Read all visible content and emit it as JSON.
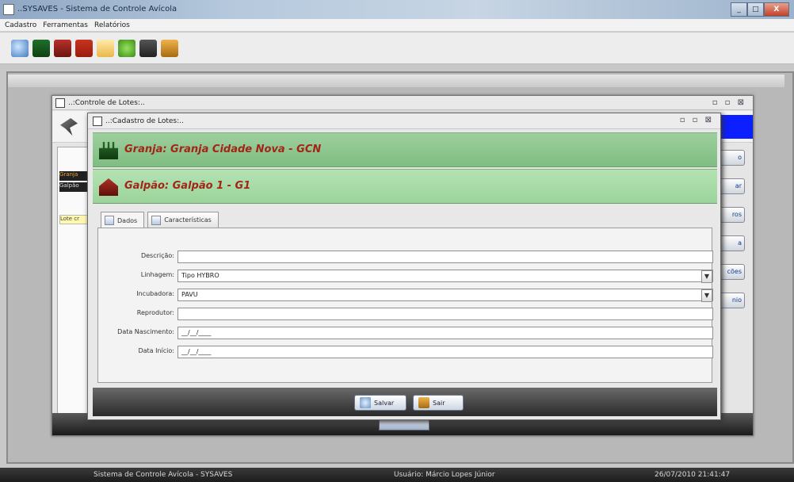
{
  "window": {
    "title": "..SYSAVES - Sistema de Controle Avícola",
    "controls": [
      "_",
      "□",
      "X"
    ]
  },
  "menu": [
    "Cadastro",
    "Ferramentas",
    "Relatórios"
  ],
  "toolbar": {
    "icons": [
      "world-icon",
      "farm-icon",
      "barn-icon",
      "bird-icon",
      "document-icon",
      "leaf-icon",
      "book-icon",
      "exit-door-icon"
    ]
  },
  "lotes_window": {
    "title": "..:Controle de Lotes:..",
    "granja_tag": "Granja",
    "galpao_tag": "Galpão",
    "lote_tag": "Lote cr",
    "side_buttons": [
      "o",
      "ar",
      "ros",
      "a",
      "cões",
      "nio"
    ]
  },
  "cadastro_window": {
    "title": "..:Cadastro de Lotes:..",
    "granja_banner": "Granja: Granja Cidade Nova - GCN",
    "galpao_banner": "Galpão: Galpão 1 - G1",
    "tabs": [
      {
        "label": "Dados",
        "active": true
      },
      {
        "label": "Características",
        "active": false
      }
    ],
    "fields": {
      "descricao": {
        "label": "Descrição:",
        "value": ""
      },
      "linhagem": {
        "label": "Linhagem:",
        "value": "Tipo HYBRO"
      },
      "incubadora": {
        "label": "Incubadora:",
        "value": "PAVU"
      },
      "reprodutor": {
        "label": "Reprodutor:",
        "value": ""
      },
      "data_nascimento": {
        "label": "Data Nascimento:",
        "value": "__/__/____"
      },
      "data_inicio": {
        "label": "Data Início:",
        "value": "__/__/____"
      }
    },
    "buttons": {
      "save": "Salvar",
      "exit": "Sair"
    }
  },
  "status": {
    "system": "Sistema de Controle Avícola - SYSAVES",
    "user": "Usuário: Márcio Lopes Júnior",
    "datetime": "26/07/2010 21:41:47"
  },
  "colors": {
    "banner_text": "#a22518",
    "granja_banner": "#8cc68c",
    "galpao_banner": "#a6daa5",
    "blue_accent": "#0b1fff"
  }
}
